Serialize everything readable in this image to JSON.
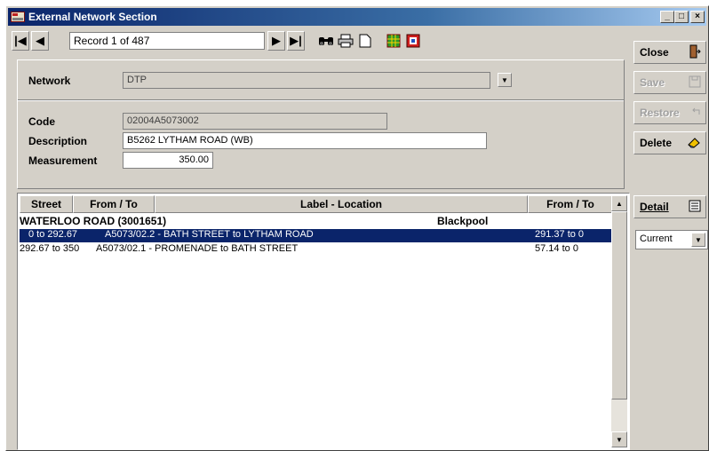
{
  "window": {
    "title": "External Network Section",
    "controls": {
      "minimize": "_",
      "maximize": "□",
      "close": "×"
    }
  },
  "toolbar": {
    "record_indicator": "Record 1 of 487",
    "icons": [
      "first-record-icon",
      "previous-record-icon",
      "next-record-icon",
      "last-record-icon",
      "binoculars-icon",
      "printer-icon",
      "new-document-icon",
      "grid-view-icon",
      "map-icon"
    ]
  },
  "side_buttons": {
    "close": "Close",
    "save": "Save",
    "restore": "Restore",
    "delete": "Delete",
    "detail": "Detail",
    "filter_value": "Current"
  },
  "form": {
    "network_label": "Network",
    "network_value": "DTP",
    "code_label": "Code",
    "code_value": "02004A5073002",
    "description_label": "Description",
    "description_value": "B5262 LYTHAM ROAD (WB)",
    "measurement_label": "Measurement",
    "measurement_value": "350.00"
  },
  "grid": {
    "columns": [
      "Street",
      "From / To",
      "Label - Location",
      "From / To"
    ],
    "group_header": {
      "street": "WATERLOO ROAD (3001651)",
      "location": "Blackpool"
    },
    "rows": [
      {
        "from_to": "0 to 292.67",
        "label": "A5073/02.2 - BATH STREET to LYTHAM ROAD",
        "ext_from_to": "291.37 to 0",
        "selected": true
      },
      {
        "from_to": "292.67 to 350",
        "label": "A5073/02.1 - PROMENADE to BATH STREET",
        "ext_from_to": "57.14 to 0",
        "selected": false
      }
    ]
  },
  "colors": {
    "title_gradient_start": "#0a246a",
    "selection": "#0a246a",
    "face": "#d4d0c8"
  }
}
